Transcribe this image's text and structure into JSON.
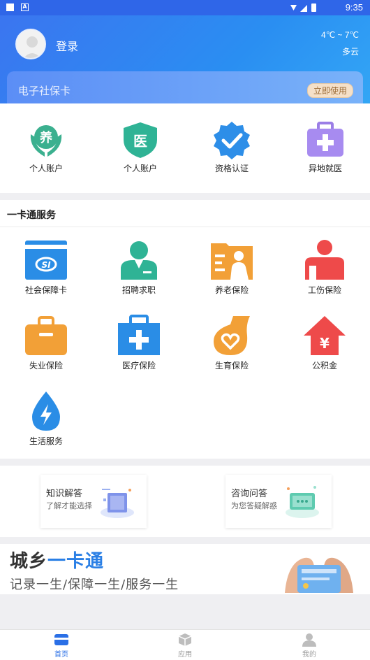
{
  "status_bar": {
    "time": "9:35",
    "colors": {
      "bar": "#2f66e8"
    }
  },
  "header": {
    "login_label": "登录",
    "weather_temp": "4℃ ~ 7℃",
    "weather_desc": "多云",
    "card_title": "电子社保卡",
    "card_button": "立即使用"
  },
  "quick_items": [
    {
      "label": "个人账户",
      "icon": "yang-hands-icon"
    },
    {
      "label": "个人账户",
      "icon": "yi-shield-icon"
    },
    {
      "label": "资格认证",
      "icon": "check-badge-icon"
    },
    {
      "label": "异地就医",
      "icon": "medical-case-icon"
    }
  ],
  "services": {
    "title": "一卡通服务",
    "items": [
      {
        "label": "社会保障卡",
        "icon": "si-card-icon"
      },
      {
        "label": "招聘求职",
        "icon": "person-suit-icon"
      },
      {
        "label": "养老保险",
        "icon": "elderly-folder-icon"
      },
      {
        "label": "工伤保险",
        "icon": "injured-person-icon"
      },
      {
        "label": "失业保险",
        "icon": "briefcase-icon"
      },
      {
        "label": "医疗保险",
        "icon": "first-aid-icon"
      },
      {
        "label": "生育保险",
        "icon": "heart-vase-icon"
      },
      {
        "label": "公积金",
        "icon": "house-yen-icon"
      },
      {
        "label": "生活服务",
        "icon": "water-bolt-icon"
      }
    ]
  },
  "help_cards": [
    {
      "title": "知识解答",
      "subtitle": "了解才能选择",
      "icon": "book-illustration-icon"
    },
    {
      "title": "咨询问答",
      "subtitle": "为您答疑解惑",
      "icon": "chat-illustration-icon"
    }
  ],
  "banner": {
    "title_part1": "城乡",
    "title_part2": "一卡通",
    "subtitle": "记录一生/保障一生/服务一生"
  },
  "tabs": [
    {
      "label": "首页",
      "active": true,
      "icon": "wallet-icon"
    },
    {
      "label": "应用",
      "active": false,
      "icon": "cube-icon"
    },
    {
      "label": "我的",
      "active": false,
      "icon": "user-icon"
    }
  ]
}
